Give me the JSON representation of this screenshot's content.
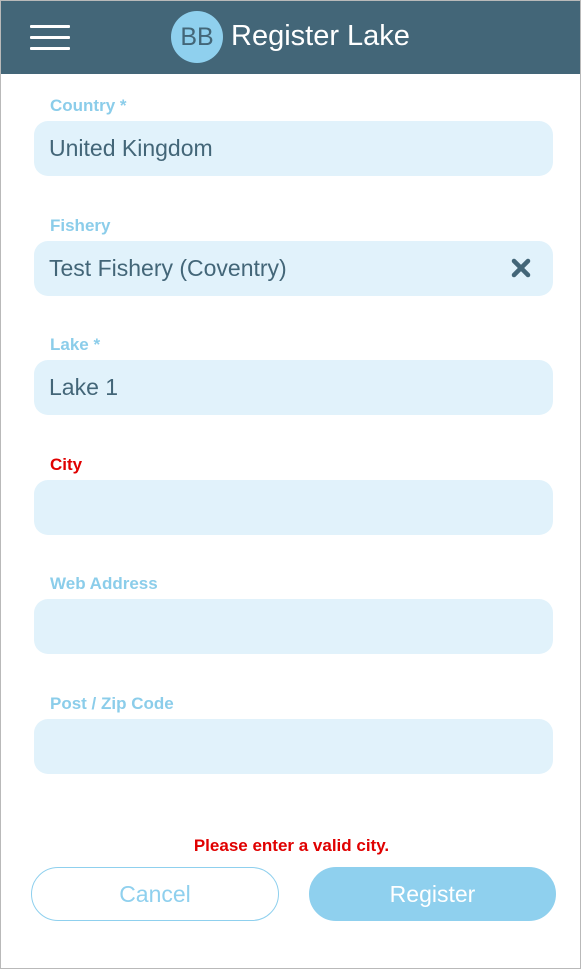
{
  "header": {
    "menu_icon": "hamburger-menu-icon",
    "logo_text": "BB",
    "title": "Register Lake"
  },
  "form": {
    "country": {
      "label": "Country *",
      "value": "United Kingdom"
    },
    "fishery": {
      "label": "Fishery",
      "value": "Test Fishery (Coventry)",
      "clear_icon": "close-x-icon"
    },
    "lake": {
      "label": "Lake *",
      "value": "Lake 1"
    },
    "city": {
      "label": "City",
      "value": ""
    },
    "web_address": {
      "label": "Web Address",
      "value": ""
    },
    "post_code": {
      "label": "Post / Zip Code",
      "value": ""
    }
  },
  "error_message": "Please enter a valid city.",
  "actions": {
    "cancel_label": "Cancel",
    "register_label": "Register"
  },
  "colors": {
    "header_bg": "#436678",
    "accent": "#8fd0ee",
    "field_bg": "#e1f2fb",
    "error": "#e00000"
  }
}
